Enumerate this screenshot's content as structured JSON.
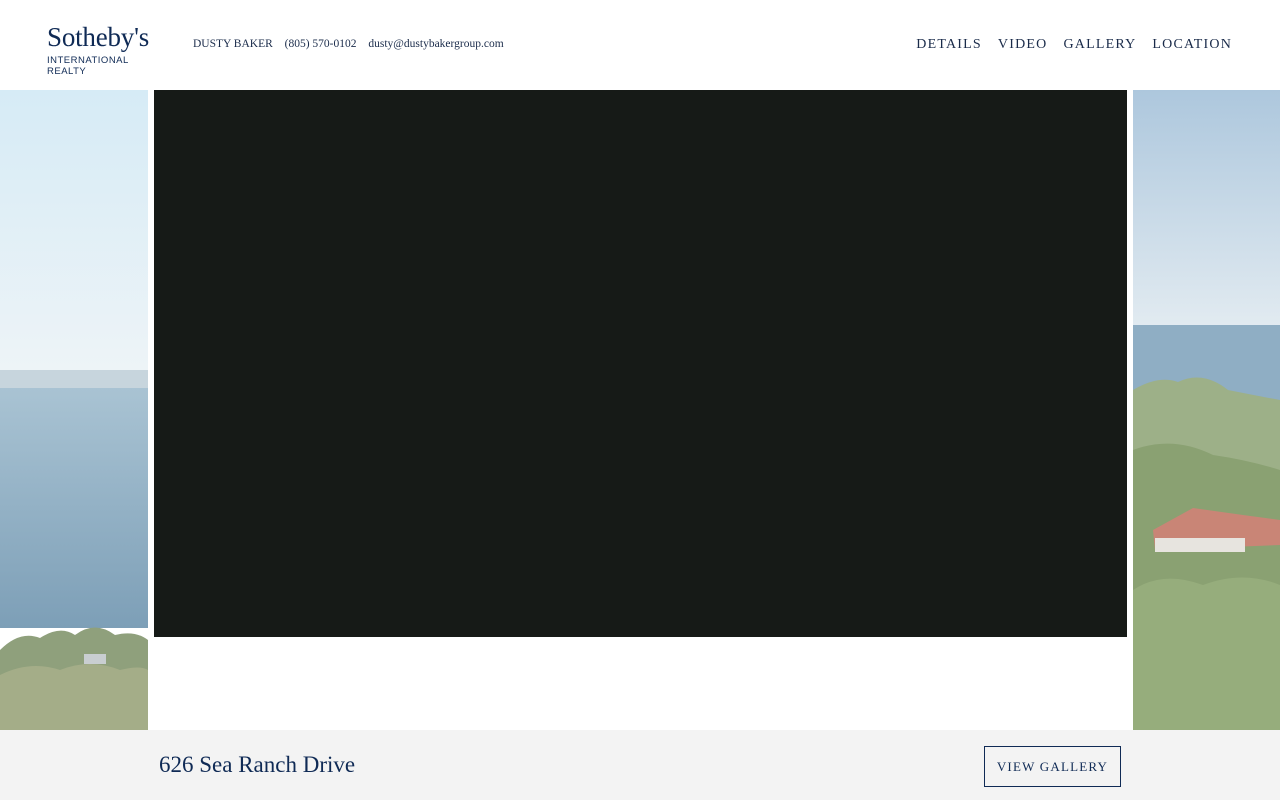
{
  "header": {
    "logo": {
      "brand": "Sotheby's",
      "subtitle": "INTERNATIONAL REALTY"
    },
    "contact": {
      "agent_name": "DUSTY BAKER",
      "phone": "(805) 570-0102",
      "email": "dusty@dustybakergroup.com"
    },
    "nav": [
      {
        "label": "DETAILS"
      },
      {
        "label": "VIDEO"
      },
      {
        "label": "GALLERY"
      },
      {
        "label": "LOCATION"
      }
    ]
  },
  "footer": {
    "address": "626 Sea Ranch Drive",
    "view_gallery_label": "VIEW GALLERY"
  },
  "colors": {
    "brand_navy": "#0f2a55",
    "video_bg": "#161a17",
    "footer_bg": "#f3f3f3"
  },
  "icons": []
}
